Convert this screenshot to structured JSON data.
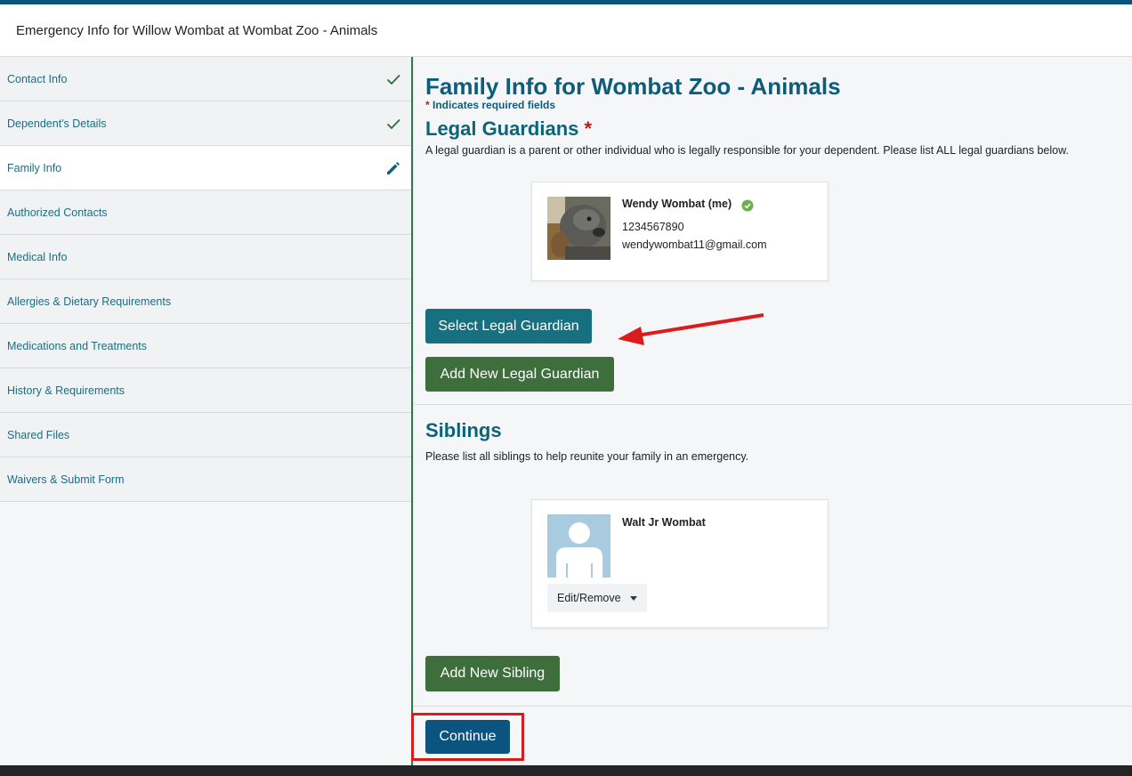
{
  "header": {
    "title": "Emergency Info for Willow Wombat at Wombat Zoo - Animals"
  },
  "sidebar": {
    "items": [
      {
        "label": "Contact Info",
        "status": "complete"
      },
      {
        "label": "Dependent's Details",
        "status": "complete"
      },
      {
        "label": "Family Info",
        "status": "editing"
      },
      {
        "label": "Authorized Contacts",
        "status": ""
      },
      {
        "label": "Medical Info",
        "status": ""
      },
      {
        "label": "Allergies & Dietary Requirements",
        "status": ""
      },
      {
        "label": "Medications and Treatments",
        "status": ""
      },
      {
        "label": "History & Requirements",
        "status": ""
      },
      {
        "label": "Shared Files",
        "status": ""
      },
      {
        "label": "Waivers & Submit Form",
        "status": ""
      }
    ]
  },
  "main": {
    "title": "Family Info for Wombat Zoo - Animals",
    "required_note": "Indicates required fields",
    "required_star": "*",
    "legal": {
      "heading": "Legal Guardians",
      "star": "*",
      "description": "A legal guardian is a parent or other individual who is legally responsible for your dependent. Please list ALL legal guardians below.",
      "guardian": {
        "name": "Wendy Wombat (me)",
        "phone": "1234567890",
        "email": "wendywombat11@gmail.com"
      },
      "select_button": "Select Legal Guardian",
      "add_button": "Add New Legal Guardian"
    },
    "siblings": {
      "heading": "Siblings",
      "description": "Please list all siblings to help reunite your family in an emergency.",
      "sibling": {
        "name": "Walt Jr Wombat",
        "menu_label": "Edit/Remove"
      },
      "add_button": "Add New Sibling"
    },
    "continue_button": "Continue"
  },
  "colors": {
    "accent_teal": "#16707f",
    "accent_green": "#3d6e3c",
    "brand_blue": "#0c5480",
    "annotation_red": "#d91c1c",
    "verified_green": "#6ab04c"
  },
  "icons": {
    "complete": "check-icon",
    "editing": "pencil-icon",
    "verified": "verified-badge-icon",
    "menu": "caret-down-icon"
  }
}
